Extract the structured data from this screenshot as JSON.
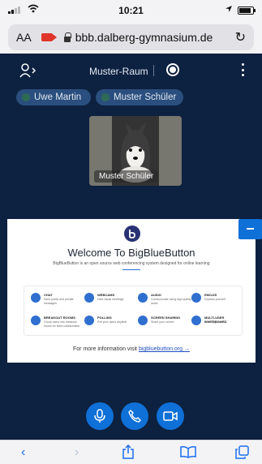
{
  "status_bar": {
    "time": "10:21"
  },
  "browser": {
    "text_size": "AA",
    "url": "bbb.dalberg-gymnasium.de",
    "reload": "↻"
  },
  "meeting": {
    "room_title": "Muster-Raum"
  },
  "talkers": [
    "Uwe Martin",
    "Muster Schüler"
  ],
  "video": {
    "name": "Muster Schüler"
  },
  "presentation": {
    "title": "Welcome To BigBlueButton",
    "subtitle": "BigBlueButton is an open source web conferencing system designed for online learning",
    "features": [
      {
        "title": "CHAT",
        "desc": "Send public and private messages"
      },
      {
        "title": "WEBCAMS",
        "desc": "Hold visual meetings"
      },
      {
        "title": "AUDIO",
        "desc": "Communicate using high quality audio"
      },
      {
        "title": "EMOJIS",
        "desc": "Express yourself"
      },
      {
        "title": "BREAKOUT ROOMS",
        "desc": "Group users into breakout rooms for team collaboration"
      },
      {
        "title": "POLLING",
        "desc": "Poll your users anytime"
      },
      {
        "title": "SCREEN SHARING",
        "desc": "Share your screen"
      },
      {
        "title": "MULTI-USER WHITEBOARD",
        "desc": "Draw together"
      }
    ],
    "footer_text": "For more information visit",
    "footer_link": "bigbluebutton.org →"
  },
  "toolbar": {
    "back": "‹",
    "forward": "›"
  },
  "colors": {
    "accent": "#0f70d7",
    "background": "#0d2140",
    "chip": "#2a4f7e"
  }
}
